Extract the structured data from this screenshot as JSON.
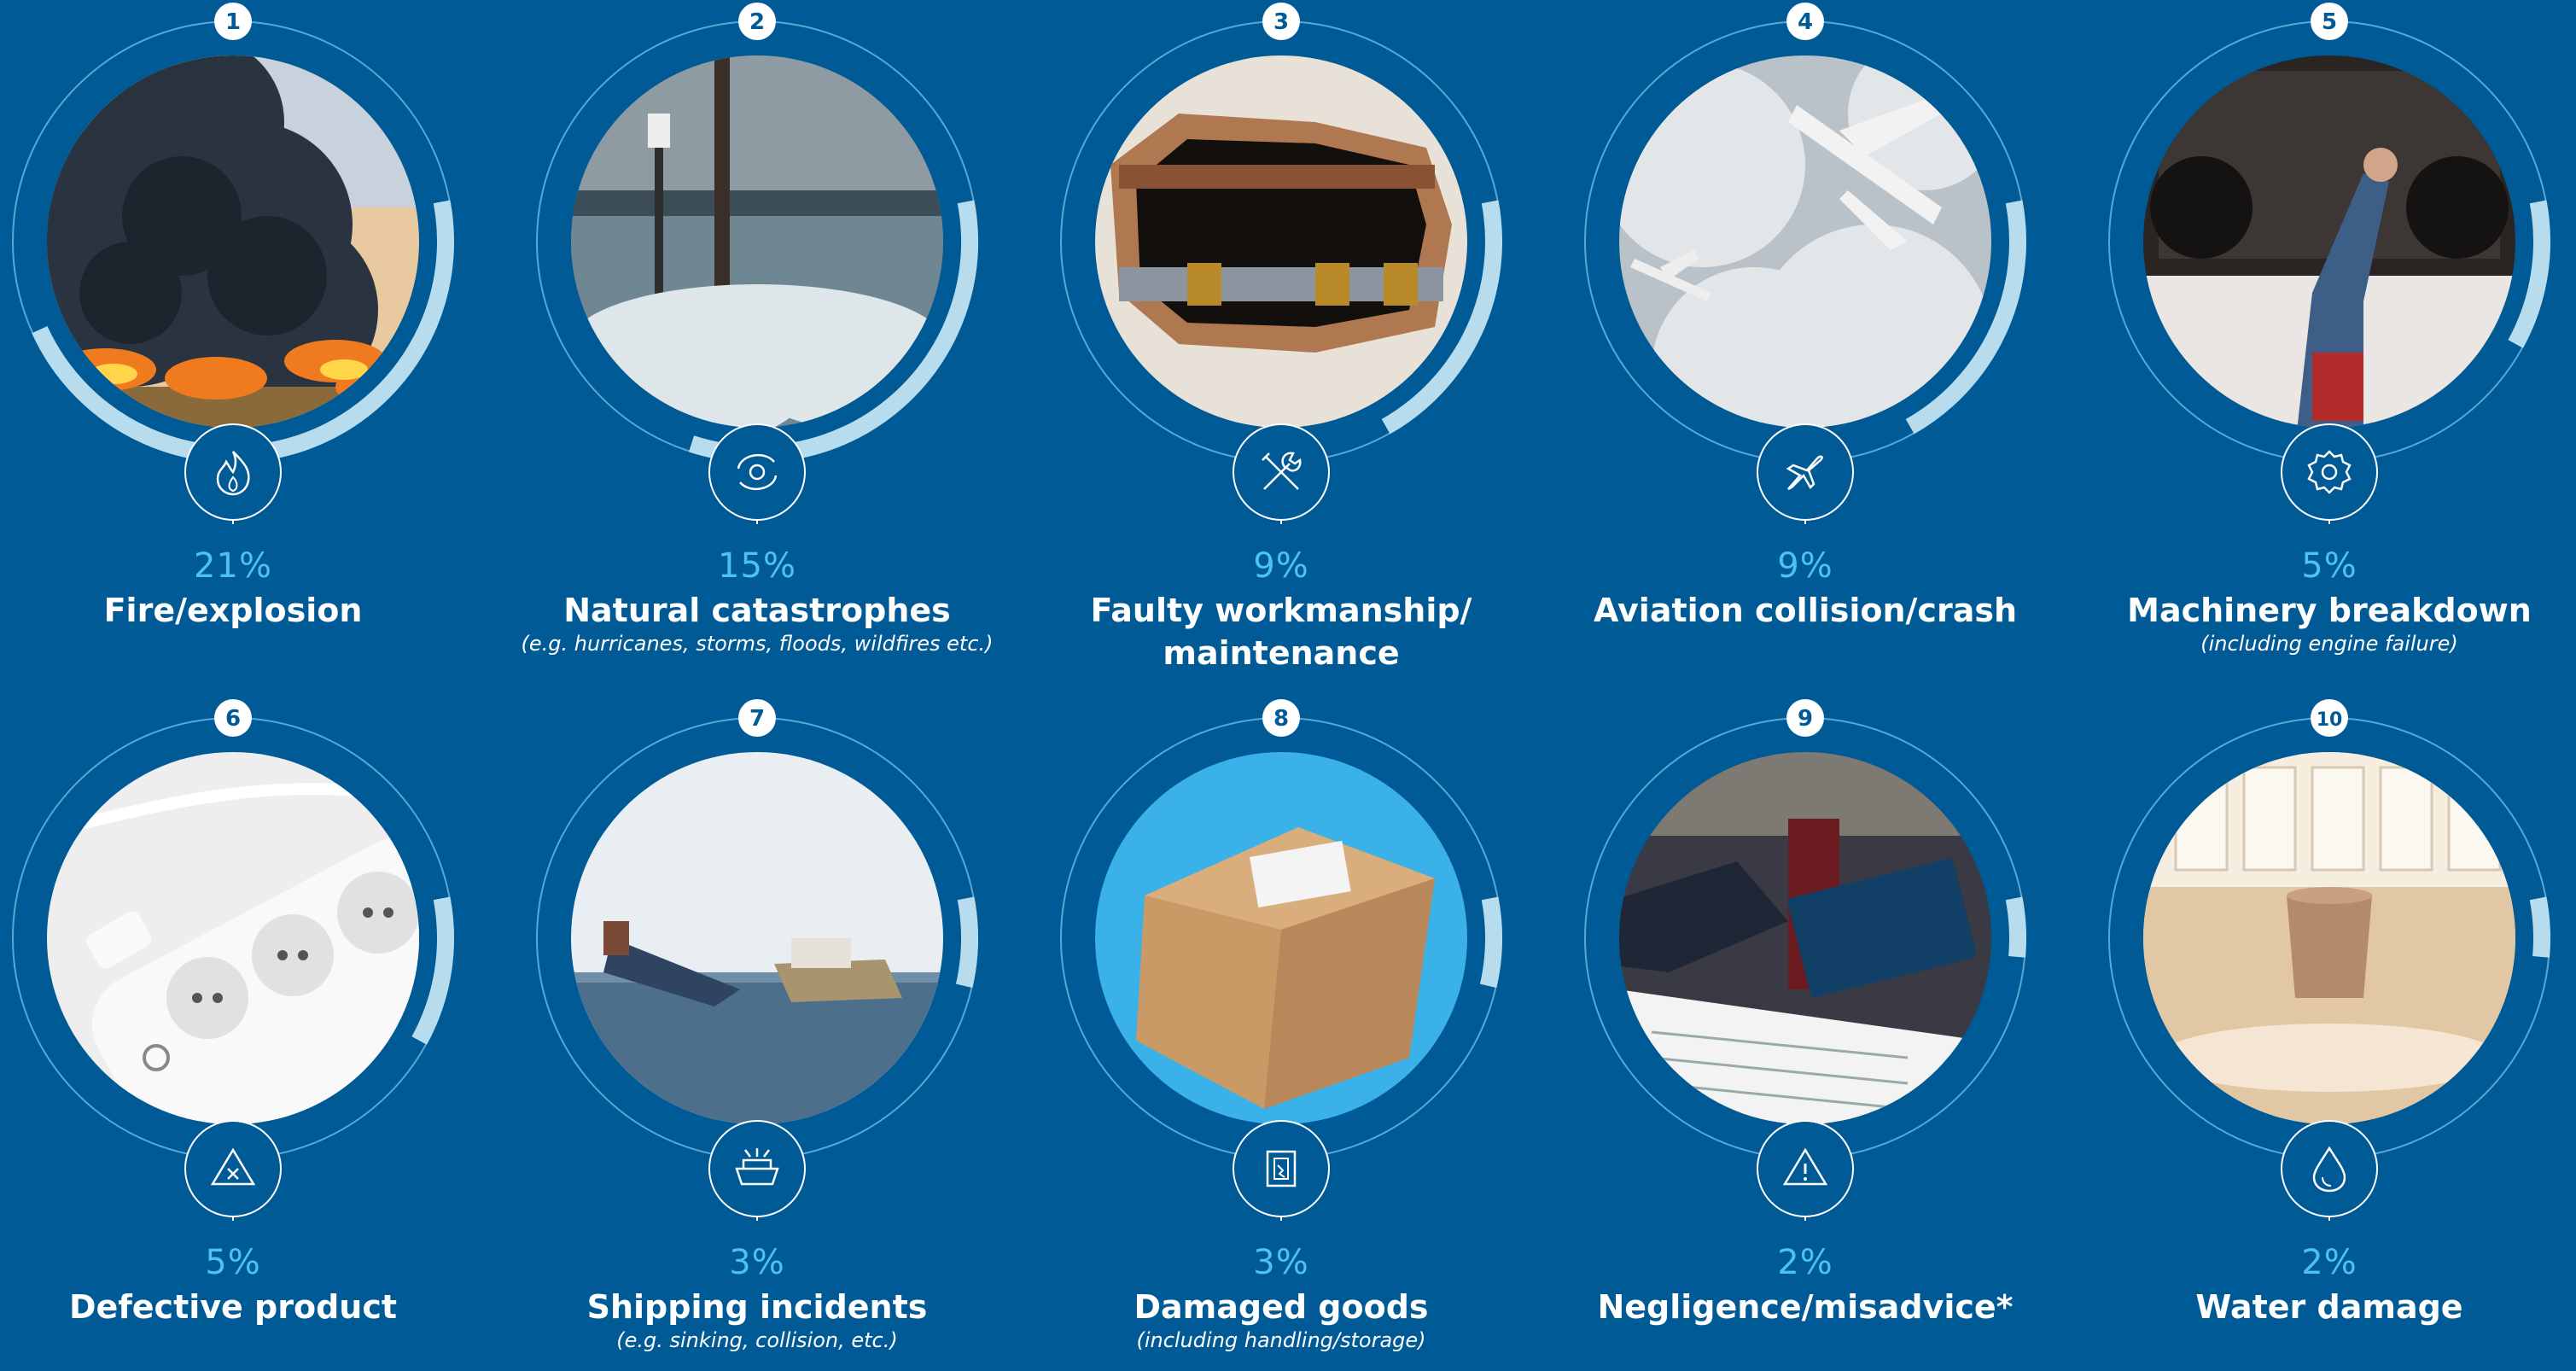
{
  "colors": {
    "background": "#005a96",
    "percent": "#4cc2ee",
    "ring_track": "#5aa7d6",
    "ring_fill": "#b7dcee",
    "text": "#ffffff"
  },
  "items": [
    {
      "rank": "1",
      "percent": "21%",
      "share": 0.21,
      "title": "Fire/explosion",
      "title2": "",
      "subtitle": "",
      "icon": "flame-icon",
      "photo": "fire-smoke-photo"
    },
    {
      "rank": "2",
      "percent": "15%",
      "share": 0.15,
      "title": "Natural catastrophes",
      "title2": "",
      "subtitle": "(e.g. hurricanes, storms, floods, wildfires etc.)",
      "icon": "cyclone-icon",
      "photo": "storm-flood-photo"
    },
    {
      "rank": "3",
      "percent": "9%",
      "share": 0.09,
      "title": "Faulty workmanship/",
      "title2": "maintenance",
      "subtitle": "",
      "icon": "tools-icon",
      "photo": "broken-pipe-photo"
    },
    {
      "rank": "4",
      "percent": "9%",
      "share": 0.09,
      "title": "Aviation collision/crash",
      "title2": "",
      "subtitle": "",
      "icon": "airplane-icon",
      "photo": "airplanes-photo"
    },
    {
      "rank": "5",
      "percent": "5%",
      "share": 0.05,
      "title": "Machinery breakdown",
      "title2": "",
      "subtitle": "(including engine failure)",
      "icon": "gear-icon",
      "photo": "mechanic-photo"
    },
    {
      "rank": "6",
      "percent": "5%",
      "share": 0.05,
      "title": "Defective product",
      "title2": "",
      "subtitle": "",
      "icon": "warning-x-icon",
      "photo": "power-strip-photo"
    },
    {
      "rank": "7",
      "percent": "3%",
      "share": 0.03,
      "title": "Shipping incidents",
      "title2": "",
      "subtitle": "(e.g. sinking, collision, etc.)",
      "icon": "ship-icon",
      "photo": "sinking-ship-photo"
    },
    {
      "rank": "8",
      "percent": "3%",
      "share": 0.03,
      "title": "Damaged goods",
      "title2": "",
      "subtitle": "(including handling/storage)",
      "icon": "damaged-box-icon",
      "photo": "damaged-box-photo"
    },
    {
      "rank": "9",
      "percent": "2%",
      "share": 0.02,
      "title": "Negligence/misadvice*",
      "title2": "",
      "subtitle": "",
      "icon": "warning-icon",
      "photo": "advisors-photo"
    },
    {
      "rank": "10",
      "percent": "2%",
      "share": 0.02,
      "title": "Water damage",
      "title2": "",
      "subtitle": "",
      "icon": "water-drop-icon",
      "photo": "water-floor-photo"
    }
  ]
}
